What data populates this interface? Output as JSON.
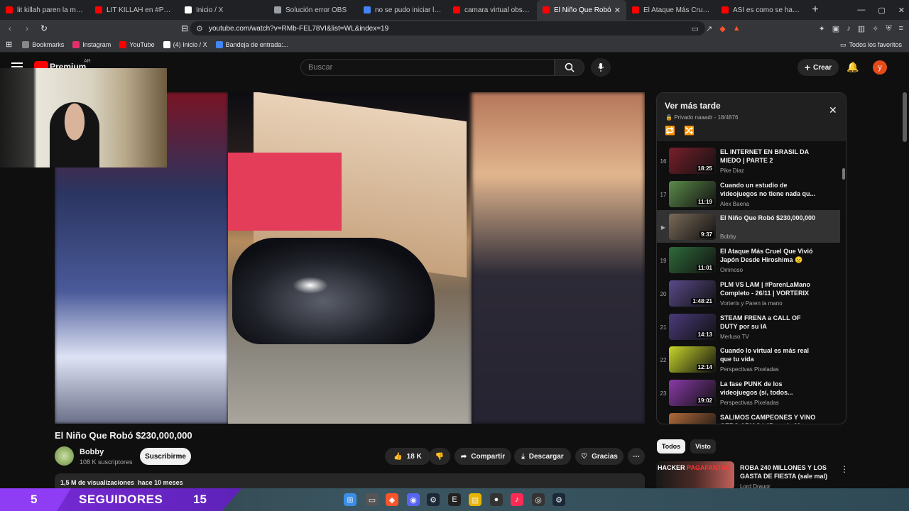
{
  "browser": {
    "tabs": [
      {
        "title": "lit killah paren la mano - Y",
        "color": "#ff0000",
        "active": false
      },
      {
        "title": "LIT KILLAH en #ParenLaMa",
        "color": "#ff0000",
        "active": false
      },
      {
        "title": "Inicio / X",
        "color": "#ffffff",
        "active": false
      },
      {
        "title": "Solución error OBS",
        "color": "#9aa0a6",
        "active": false
      },
      {
        "title": "no se pudo iniciar la salid",
        "color": "#4285f4",
        "active": false
      },
      {
        "title": "camara virtual obs no me",
        "color": "#ff0000",
        "active": false
      },
      {
        "title": "El Niño Que Robó",
        "color": "#ff0000",
        "active": true
      },
      {
        "title": "El Ataque Más Cruel Que",
        "color": "#ff0000",
        "active": false
      },
      {
        "title": "ASÍ es como se hace un B",
        "color": "#ff0000",
        "active": false
      }
    ],
    "new_tab": "+",
    "url": "youtube.com/watch?v=RMb-FEL78VI&list=WL&index=19",
    "bookmarks": [
      {
        "label": "Bookmarks",
        "color": "#888888"
      },
      {
        "label": "Instagram",
        "color": "#e1306c"
      },
      {
        "label": "YouTube",
        "color": "#ff0000"
      },
      {
        "label": "(4) Inicio / X",
        "color": "#ffffff"
      },
      {
        "label": "Bandeja de entrada:...",
        "color": "#4285f4"
      }
    ],
    "all_favorites": "Todos los favoritos"
  },
  "youtube": {
    "brand": "Premium",
    "region": "AR",
    "search_placeholder": "Buscar",
    "create_label": "Crear",
    "avatar_letter": "y"
  },
  "video": {
    "title": "El Niño Que Robó $230,000,000",
    "channel": "Bobby",
    "subscribers": "108 K suscriptores",
    "subscribe_label": "Suscribirme",
    "likes": "18 K",
    "share_label": "Compartir",
    "download_label": "Descargar",
    "thanks_label": "Gracias",
    "views": "1,5 M de visualizaciones",
    "age": "hace 10 meses"
  },
  "playlist": {
    "title": "Ver más tarde",
    "meta": "Privado naaadr - 18/4876",
    "items": [
      {
        "num": "16",
        "title": "EL INTERNET EN BRASIL DA MIEDO | PARTE 2",
        "channel": "Pike Diaz",
        "duration": "18:25",
        "thumb": "#7a1f2b"
      },
      {
        "num": "17",
        "title": "Cuando un estudio de videojuegos no tiene nada qu...",
        "channel": "Alex Baena",
        "duration": "11:19",
        "thumb": "#5c8a4a"
      },
      {
        "num": "▶",
        "title": "El Niño Que Robó $230,000,000",
        "channel": "Bobby",
        "duration": "9:37",
        "thumb": "#7a6a58"
      },
      {
        "num": "19",
        "title": "El Ataque Más Cruel Que Vivió Japón Desde Hiroshima 😟",
        "channel": "Ominoso",
        "duration": "11:01",
        "thumb": "#2f6b3a"
      },
      {
        "num": "20",
        "title": "PLM VS LAM | #ParenLaMano Completo - 26/11 | VORTERIX",
        "channel": "Vorterix y Paren la mano",
        "duration": "1:48:21",
        "thumb": "#5a4a8a"
      },
      {
        "num": "21",
        "title": "STEAM FRENA a CALL OF DUTY por su IA",
        "channel": "Merluso TV",
        "duration": "14:13",
        "thumb": "#4a3a7a"
      },
      {
        "num": "22",
        "title": "Cuando lo virtual es más real que tu vida",
        "channel": "Perspectivas Pixeladas",
        "duration": "12:14",
        "thumb": "#c8d62a"
      },
      {
        "num": "23",
        "title": "La fase PUNK de los videojuegos (sí, todos...",
        "channel": "Perspectivas Pixeladas",
        "duration": "19:02",
        "thumb": "#8a3aa8"
      },
      {
        "num": "24",
        "title": "SALIMOS CAMPEONES Y VINO GERO ARIAS | #ParenLaMano",
        "channel": "",
        "duration": "",
        "thumb": "#b06a3a"
      }
    ]
  },
  "chips": {
    "all": "Todos",
    "seen": "Visto"
  },
  "recommendation": {
    "tag1": "HACKER",
    "tag2": "PAGAFANTAS",
    "title": "ROBA 240 MILLONES Y LOS GASTA DE FIESTA (sale mal)",
    "channel": "Lord Draugr"
  },
  "stream_overlay": {
    "count_left": "5",
    "label": "SEGUIDORES",
    "count_right": "15"
  }
}
